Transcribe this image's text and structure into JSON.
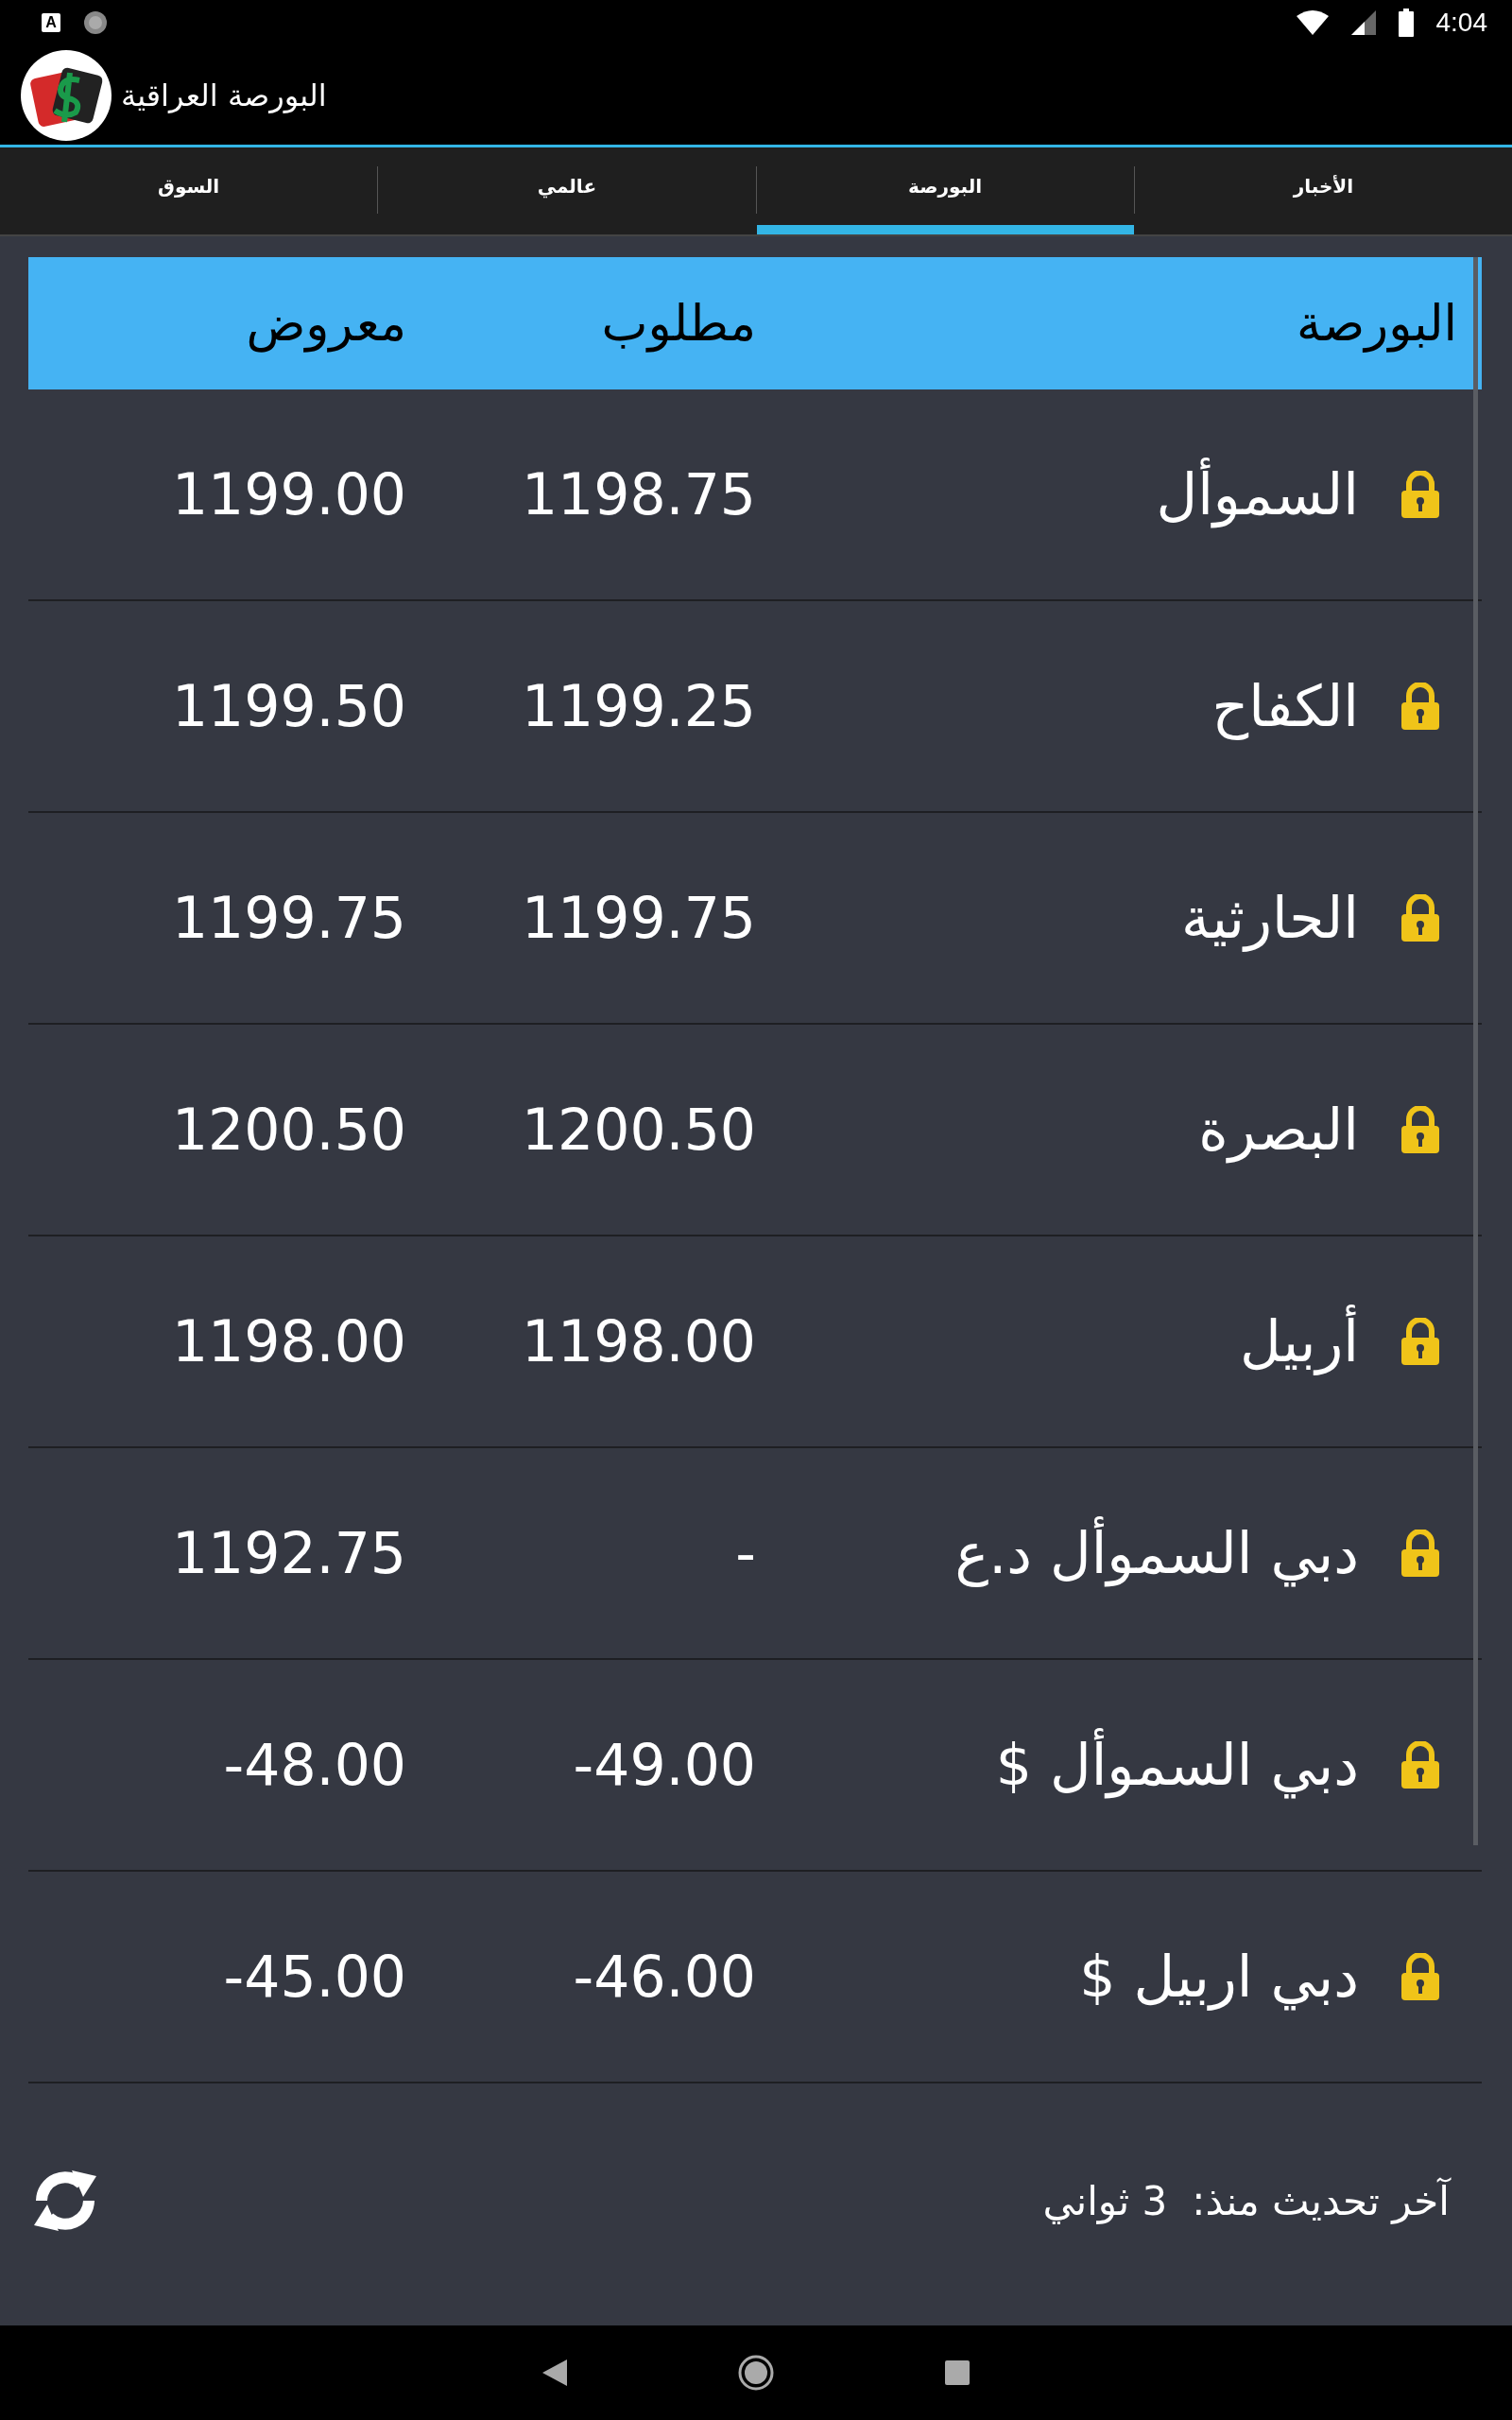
{
  "status_bar": {
    "notification_glyph": "A",
    "time": "4:04"
  },
  "app_bar": {
    "title": "البورصة العراقية"
  },
  "tabs": [
    {
      "label": "الأخبار",
      "selected": false
    },
    {
      "label": "البورصة",
      "selected": true
    },
    {
      "label": "عالمي",
      "selected": false
    },
    {
      "label": "السوق",
      "selected": false
    }
  ],
  "table": {
    "columns": [
      "البورصة",
      "مطلوب",
      "معروض"
    ],
    "rows": [
      {
        "name": "السموأل",
        "bid": "1198.75",
        "offer": "1199.00",
        "locked": true
      },
      {
        "name": "الكفاح",
        "bid": "1199.25",
        "offer": "1199.50",
        "locked": true
      },
      {
        "name": "الحارثية",
        "bid": "1199.75",
        "offer": "1199.75",
        "locked": true
      },
      {
        "name": "البصرة",
        "bid": "1200.50",
        "offer": "1200.50",
        "locked": true
      },
      {
        "name": "أربيل",
        "bid": "1198.00",
        "offer": "1198.00",
        "locked": true
      },
      {
        "name": "دبي السموأل د.ع",
        "bid": "-",
        "offer": "1192.75",
        "locked": true
      },
      {
        "name": "دبي السموأل $",
        "bid": "-49.00",
        "offer": "-48.00",
        "locked": true
      },
      {
        "name": "دبي اربيل $",
        "bid": "-46.00",
        "offer": "-45.00",
        "locked": true
      }
    ]
  },
  "footer": {
    "label": "آخر تحديث منذ:",
    "value": "3 ثواني"
  }
}
